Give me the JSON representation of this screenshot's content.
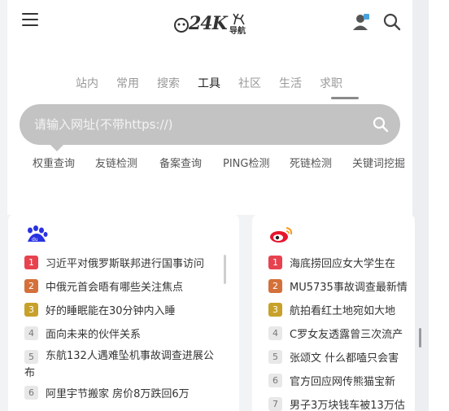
{
  "header": {
    "logo_text": "24K",
    "logo_sub": "导航",
    "icons": [
      "menu-icon",
      "user-icon",
      "search-icon"
    ]
  },
  "tabs": [
    {
      "label": "站内"
    },
    {
      "label": "常用"
    },
    {
      "label": "搜索"
    },
    {
      "label": "工具",
      "active": true
    },
    {
      "label": "社区"
    },
    {
      "label": "生活"
    },
    {
      "label": "求职"
    }
  ],
  "search": {
    "placeholder": "请输入网址(不带https://)"
  },
  "tool_links": [
    "权重查询",
    "友链检测",
    "备案查询",
    "PING检测",
    "死链检测",
    "关键词挖掘"
  ],
  "hot_lists": [
    {
      "source": "baidu",
      "items": [
        {
          "rank": "1",
          "text": "习近平对俄罗斯联邦进行国事访问"
        },
        {
          "rank": "2",
          "text": "中俄元首会晤有哪些关注焦点"
        },
        {
          "rank": "3",
          "text": "好的睡眠能在30分钟内入睡"
        },
        {
          "rank": "4",
          "text": "面向未来的伙伴关系"
        },
        {
          "rank": "5",
          "text": "东航132人遇难坠机事故调查进展公布"
        },
        {
          "rank": "6",
          "text": "阿里宇节搬家 房价8万跌回6万"
        }
      ]
    },
    {
      "source": "weibo",
      "items": [
        {
          "rank": "1",
          "text": "海底捞回应女大学生在"
        },
        {
          "rank": "2",
          "text": "MU5735事故调查最新情"
        },
        {
          "rank": "3",
          "text": "航拍看红土地宛如大地"
        },
        {
          "rank": "4",
          "text": "C罗女友透露曾三次流产"
        },
        {
          "rank": "5",
          "text": "张颂文 什么都嗑只会害"
        },
        {
          "rank": "6",
          "text": "官方回应网传熊猫宝新"
        },
        {
          "rank": "7",
          "text": "男子3万块钱车被13万估"
        }
      ]
    }
  ],
  "colors": {
    "rank1": "#e7424f",
    "rank2": "#d4703a",
    "rank3": "#c7a12a",
    "search_bg": "#c3c3c3",
    "baidu_blue": "#2932e1",
    "weibo_red": "#e6162d"
  }
}
